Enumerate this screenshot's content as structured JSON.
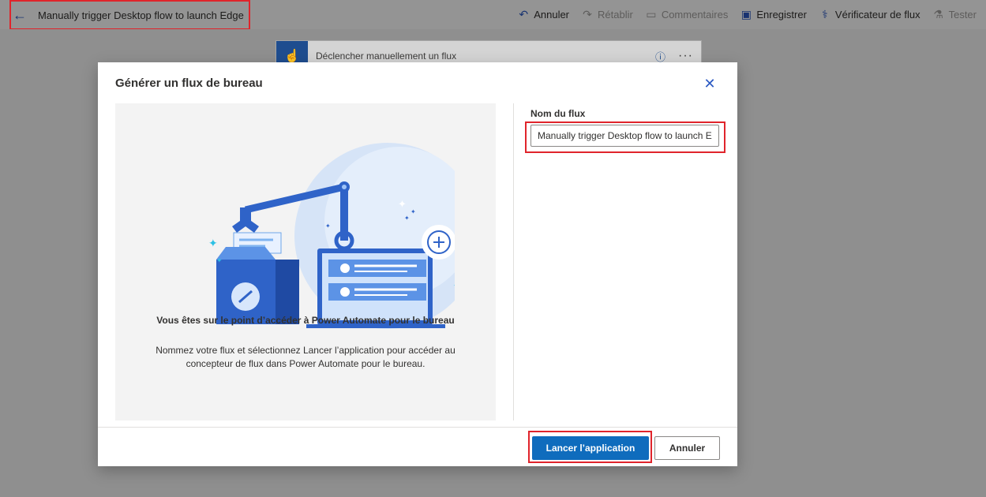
{
  "header": {
    "back_icon": "back-arrow-icon",
    "flow_title": "Manually trigger Desktop flow to launch Edge",
    "commands": [
      {
        "label": "Annuler",
        "icon": "undo-icon",
        "disabled": false
      },
      {
        "label": "Rétablir",
        "icon": "redo-icon",
        "disabled": true
      },
      {
        "label": "Commentaires",
        "icon": "comment-icon",
        "disabled": true
      },
      {
        "label": "Enregistrer",
        "icon": "save-icon",
        "disabled": false
      },
      {
        "label": "Vérificateur de flux",
        "icon": "stethoscope-icon",
        "disabled": false
      },
      {
        "label": "Tester",
        "icon": "flask-icon",
        "disabled": true
      }
    ]
  },
  "trigger_card": {
    "label": "Déclencher manuellement un flux"
  },
  "dialog": {
    "title": "Générer un flux de bureau",
    "promo_title": "Vous êtes sur le point d’accéder à Power Automate pour le bureau",
    "promo_body": "Nommez votre flux et sélectionnez Lancer l’application pour accéder au concepteur de flux dans Power Automate pour le bureau.",
    "field_label": "Nom du flux",
    "field_value": "Manually trigger Desktop flow to launch Edge",
    "primary_button": "Lancer l’application",
    "secondary_button": "Annuler"
  },
  "colors": {
    "accent": "#0f6cbd",
    "highlight": "#e0242b",
    "overlay": "#8f8f8f"
  }
}
